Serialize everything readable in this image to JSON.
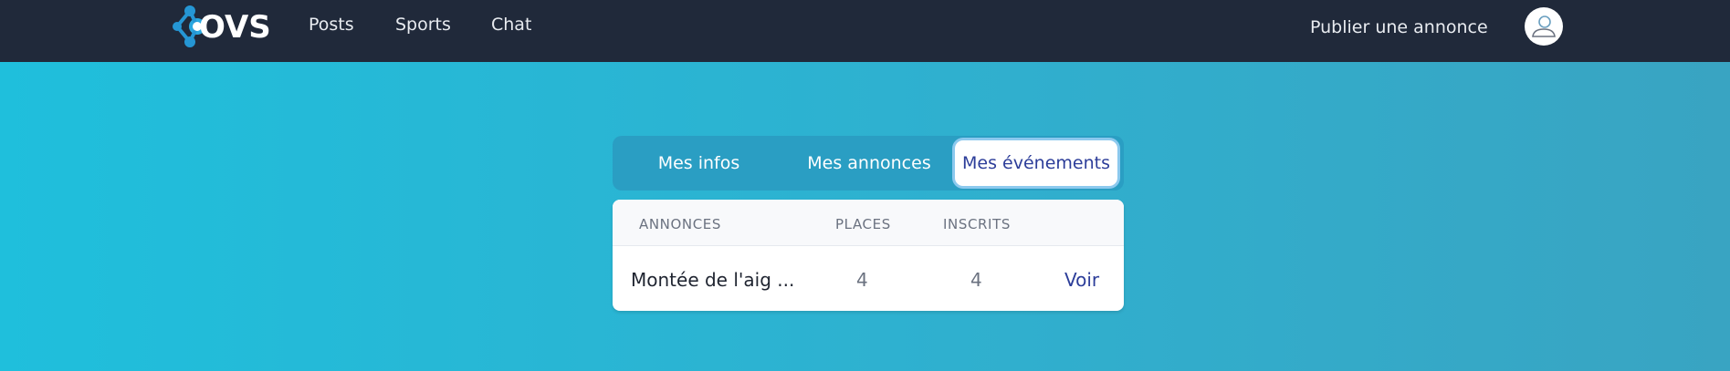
{
  "navbar": {
    "logo_text": "OVS",
    "links": [
      {
        "label": "Posts"
      },
      {
        "label": "Sports"
      },
      {
        "label": "Chat"
      }
    ],
    "publish_label": "Publier une annonce"
  },
  "tabs": [
    {
      "label": "Mes infos",
      "active": false
    },
    {
      "label": "Mes annonces",
      "active": false
    },
    {
      "label": "Mes événements",
      "active": true
    }
  ],
  "table": {
    "headers": [
      "ANNONCES",
      "PLACES",
      "INSCRITS"
    ],
    "rows": [
      {
        "annonce": "Montée de l'aig ...",
        "places": "4",
        "inscrits": "4",
        "action": "Voir"
      }
    ]
  },
  "colors": {
    "navbar_bg": "#20293a",
    "accent": "#2c3d99",
    "background_start": "#1fbfdc",
    "background_end": "#39a4c2"
  }
}
